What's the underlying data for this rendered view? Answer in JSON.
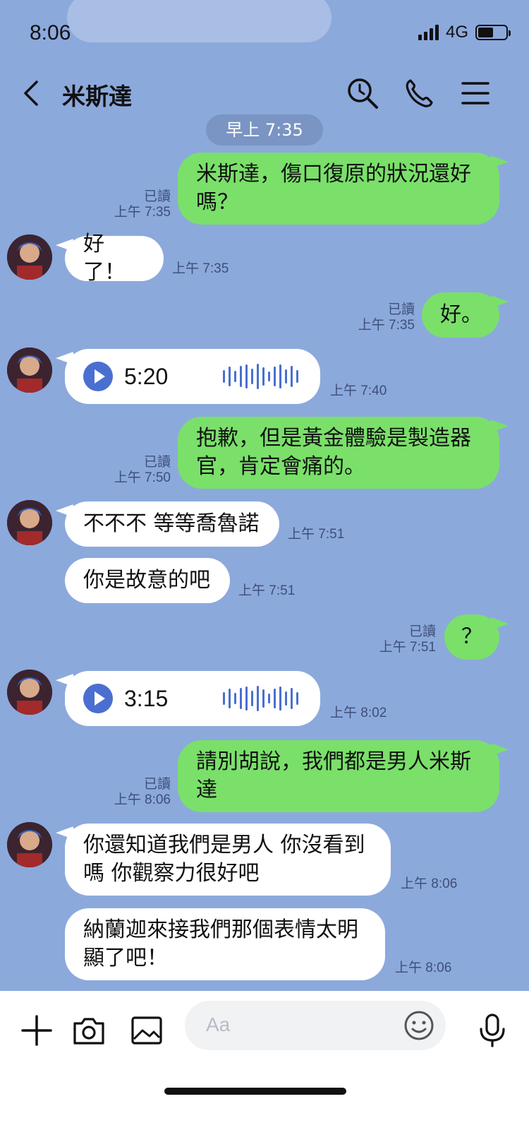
{
  "status": {
    "time": "8:06",
    "network": "4G",
    "battery_level": 0.55
  },
  "header": {
    "title": "米斯達"
  },
  "date_pill": "早上 7:35",
  "messages": [
    {
      "side": "out",
      "text": "米斯達，傷口復原的狀況還好嗎？",
      "line1": "米斯達，傷口復原的狀況還好",
      "line2": "嗎？",
      "read": "已讀",
      "time": "上午 7:35"
    },
    {
      "side": "in",
      "text": "好了！",
      "time": "上午 7:35"
    },
    {
      "side": "out",
      "text": "好。",
      "read": "已讀",
      "time": "上午 7:35"
    },
    {
      "side": "in",
      "type": "voice",
      "duration": "5:20",
      "time": "上午 7:40"
    },
    {
      "side": "out",
      "text": "抱歉，但是黃金體驗是製造器官，肯定會痛的。",
      "line1": "抱歉，但是黃金體驗是製造器",
      "line2": "官，肯定會痛的。",
      "read": "已讀",
      "time": "上午 7:50"
    },
    {
      "side": "in",
      "text": "不不不 等等喬魯諾",
      "time": "上午 7:51"
    },
    {
      "side": "in",
      "text": "你是故意的吧",
      "time": "上午 7:51"
    },
    {
      "side": "out",
      "text": "？",
      "read": "已讀",
      "time": "上午 7:51"
    },
    {
      "side": "in",
      "type": "voice",
      "duration": "3:15",
      "time": "上午 8:02"
    },
    {
      "side": "out",
      "text": "請別胡說，我們都是男人米斯達",
      "line1": "請別胡說，我們都是男人米斯",
      "line2": "達",
      "read": "已讀",
      "time": "上午 8:06"
    },
    {
      "side": "in",
      "text": "你還知道我們是男人 你沒看到嗎 你觀察力很好吧",
      "line1": "你還知道我們是男人 你沒看到",
      "line2": "嗎 你觀察力很好吧",
      "time": "上午 8:06"
    },
    {
      "side": "in",
      "text": "納蘭迦來接我們那個表情太明顯了吧！",
      "line1": "納蘭迦來接我們那個表情太明",
      "line2": "顯了吧！",
      "time": "上午 8:06"
    }
  ],
  "composer": {
    "placeholder": "Aa"
  },
  "colors": {
    "background": "#8ca9dc",
    "outgoing": "#7ae06a",
    "incoming": "#ffffff",
    "accent": "#4a6fd1"
  },
  "icons": [
    "back-icon",
    "search-icon",
    "phone-icon",
    "menu-icon",
    "plus-icon",
    "camera-icon",
    "image-icon",
    "emoji-icon",
    "mic-icon"
  ]
}
